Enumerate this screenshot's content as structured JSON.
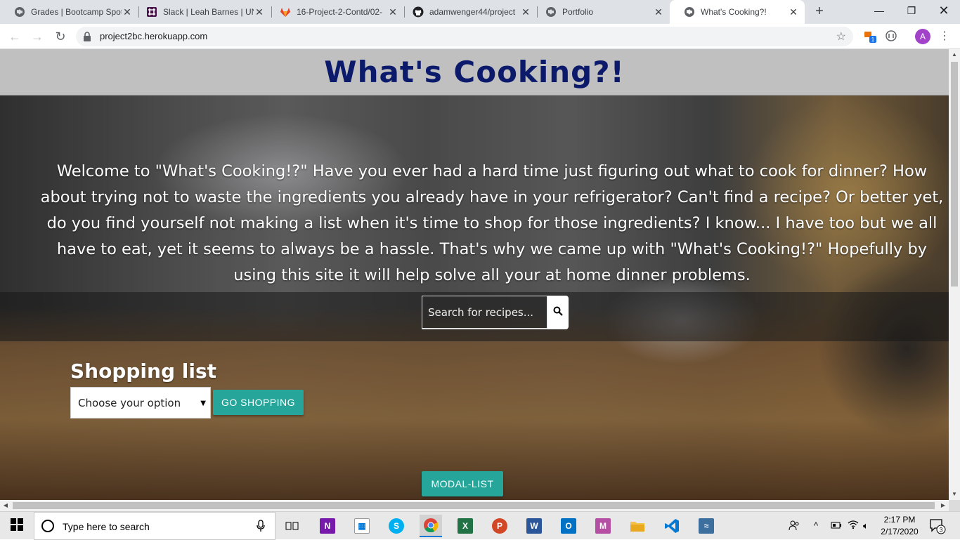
{
  "browser": {
    "tabs": [
      {
        "title": "Grades | Bootcamp Spot",
        "icon": "globe-icon"
      },
      {
        "title": "Slack | Leah Barnes | UNCC",
        "icon": "slack-icon"
      },
      {
        "title": "16-Project-2-Contd/02-",
        "icon": "gitlab-icon"
      },
      {
        "title": "adamwenger44/project",
        "icon": "github-icon"
      },
      {
        "title": "Portfolio",
        "icon": "globe-icon"
      },
      {
        "title": "What's Cooking?!",
        "icon": "globe-icon"
      }
    ],
    "url": "project2bc.herokuapp.com",
    "profile_initial": "A",
    "extension_badge": "1"
  },
  "page": {
    "site_title": "What's Cooking?!",
    "intro": "Welcome to \"What's Cooking!?\" Have you ever had a hard time just figuring out what to cook for dinner? How about trying not to waste the ingredients you already have in your refrigerator? Can't find a recipe? Or better yet, do you find yourself not making a list when it's time to shop for those ingredients? I know... I have too but we all have to eat, yet it seems to always be a hassle. That's why we came up with \"What's Cooking!?\" Hopefully by using this site it will help solve all your at home dinner problems.",
    "search": {
      "placeholder": "Search for recipes...",
      "value": ""
    },
    "shopping": {
      "title": "Shopping list",
      "select_value": "Choose your option",
      "go_button": "GO SHOPPING"
    },
    "modal_button": "MODAL-LIST"
  },
  "taskbar": {
    "search_placeholder": "Type here to search",
    "time": "2:17 PM",
    "date": "2/17/2020",
    "notification_count": "3"
  },
  "colors": {
    "title": "#0c1a6b",
    "header_bg": "#c0c0c0",
    "button_teal": "#26a69a"
  }
}
